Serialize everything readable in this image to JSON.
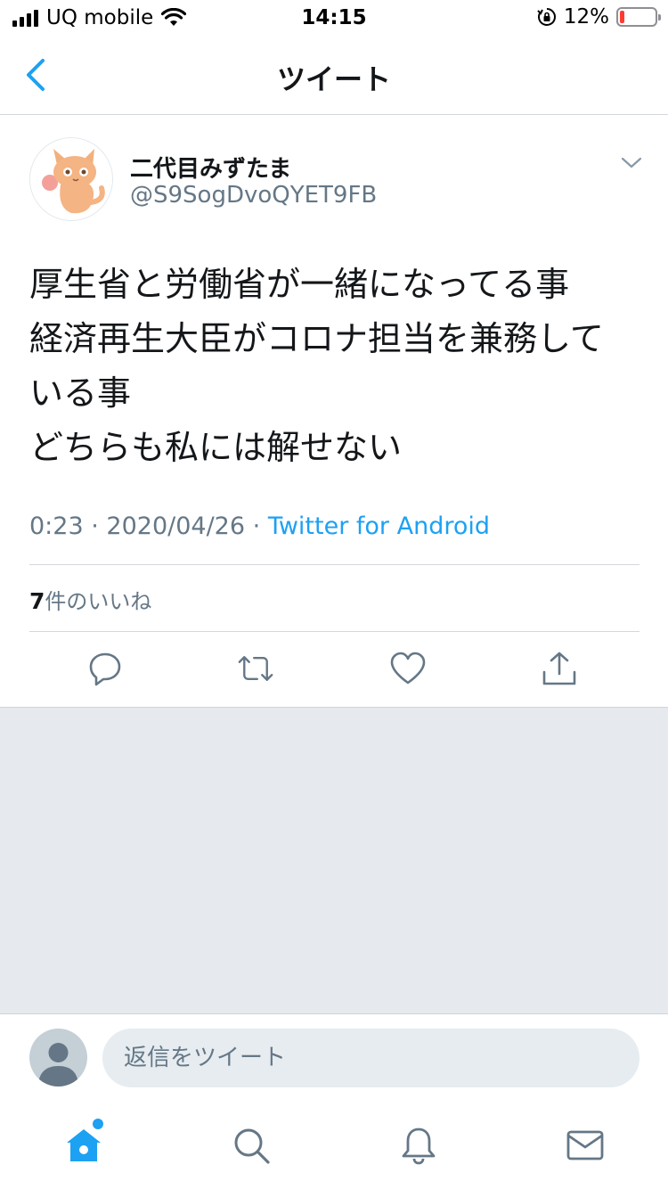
{
  "status_bar": {
    "carrier": "UQ mobile",
    "time": "14:15",
    "battery": "12%",
    "battery_level": 0.12,
    "icons": [
      "signal-icon",
      "wifi-icon",
      "orientation-lock-icon",
      "battery-icon"
    ]
  },
  "nav": {
    "title": "ツイート",
    "back_icon": "chevron-left-icon"
  },
  "tweet": {
    "display_name": "二代目みずたま",
    "handle": "@S9SogDvoQYET9FB",
    "lines": [
      "厚生省と労働省が一緒になってる事",
      "経済再生大臣がコロナ担当を兼務して",
      "いる事",
      "どちらも私には解せない"
    ],
    "time": "0:23",
    "date": "2020/04/26",
    "separator": "·",
    "source": "Twitter for Android",
    "likes_count": "7",
    "likes_label": "件のいいね"
  },
  "actions": [
    "reply-icon",
    "retweet-icon",
    "like-icon",
    "share-icon"
  ],
  "reply": {
    "placeholder": "返信をツイート"
  },
  "tab_bar": [
    "home-icon",
    "search-icon",
    "notifications-icon",
    "messages-icon"
  ],
  "colors": {
    "accent": "#1da1f2",
    "secondary_text": "#657786",
    "divider": "#d3d7dc",
    "empty_area": "#e6e9ed",
    "battery_low": "#ff3b30"
  }
}
